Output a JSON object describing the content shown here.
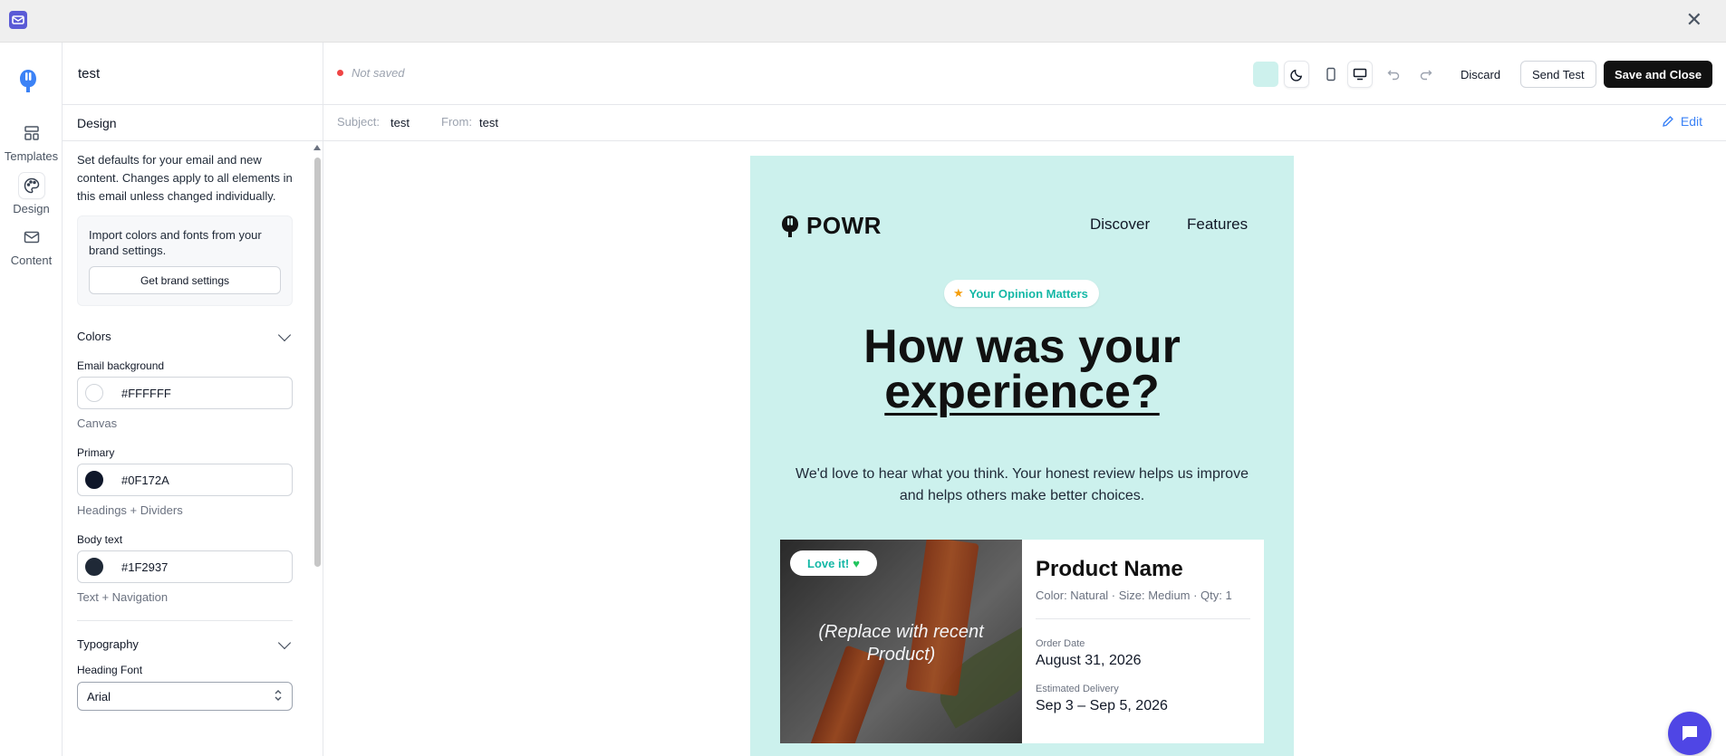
{
  "window": {
    "close_icon": "close-icon",
    "app_icon": "app-logo-icon"
  },
  "rail": {
    "items": [
      {
        "label": "Templates",
        "icon": "layout-icon"
      },
      {
        "label": "Design",
        "icon": "palette-icon"
      },
      {
        "label": "Content",
        "icon": "mail-icon"
      }
    ]
  },
  "panel": {
    "email_name": "test",
    "section_title": "Design",
    "description": "Set defaults for your email and new content. Changes apply to all elements in this email unless changed individually.",
    "brand_text": "Import colors and fonts from your brand settings.",
    "brand_button": "Get brand settings",
    "colors_heading": "Colors",
    "email_bg_label": "Email background",
    "email_bg_value": "#FFFFFF",
    "email_bg_caption": "Canvas",
    "primary_label": "Primary",
    "primary_value": "#0F172A",
    "primary_caption": "Headings + Dividers",
    "body_label": "Body text",
    "body_value": "#1F2937",
    "body_caption": "Text + Navigation",
    "typography_heading": "Typography",
    "heading_font_label": "Heading Font",
    "heading_font_value": "Arial"
  },
  "toolbar": {
    "status": "Not saved",
    "discard": "Discard",
    "send_test": "Send Test",
    "save_close": "Save and Close",
    "chip_color": "#CDF1ED"
  },
  "subject_bar": {
    "subject_label": "Subject:",
    "subject_value": "test",
    "from_label": "From:",
    "from_value": "test",
    "edit": "Edit"
  },
  "email": {
    "brand": "POWR",
    "nav": [
      "Discover",
      "Features"
    ],
    "pill": "Your Opinion Matters",
    "headline_line1": "How was your",
    "headline_line2": "experience?",
    "body": "We'd love to hear what you think. Your honest review helps us improve and helps others make better choices.",
    "card": {
      "badge": "Love it!",
      "image_text": "(Replace with recent Product)",
      "product_name": "Product Name",
      "meta": "Color: Natural · Size: Medium · Qty: 1",
      "order_date_label": "Order Date",
      "order_date": "August 31, 2026",
      "delivery_label": "Estimated Delivery",
      "delivery": "Sep 3 – Sep 5, 2026"
    },
    "background": "#CCF1ED"
  }
}
